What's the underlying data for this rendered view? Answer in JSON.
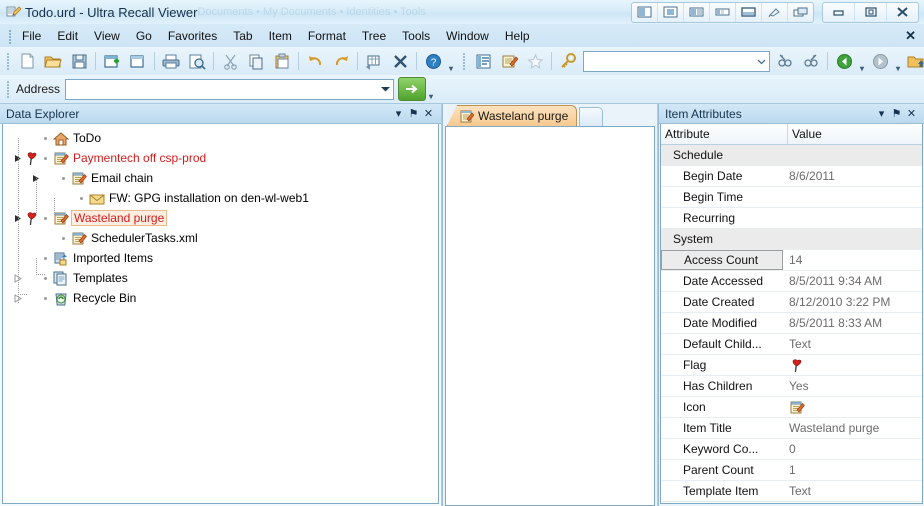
{
  "window": {
    "title": "Todo.urd - Ultra Recall Viewer",
    "app_icon": "notepad-pen-icon",
    "ghost_text": "Documents  •  My Documents  •  Identities  •  Tools",
    "layout_buttons": [
      {
        "name": "layout-split-left-icon"
      },
      {
        "name": "layout-center-icon"
      },
      {
        "name": "layout-list-right-icon"
      },
      {
        "name": "layout-columns-icon"
      },
      {
        "name": "layout-stacked-icon"
      },
      {
        "name": "layout-pin-icon"
      },
      {
        "name": "layout-cascade-icon"
      }
    ],
    "controls": [
      {
        "name": "minimize-button",
        "glyph": "–"
      },
      {
        "name": "maximize-button",
        "glyph": "□"
      },
      {
        "name": "close-button",
        "glyph": "✕"
      }
    ]
  },
  "menubar": {
    "items": [
      "File",
      "Edit",
      "View",
      "Go",
      "Favorites",
      "Tab",
      "Item",
      "Format",
      "Tree",
      "Tools",
      "Window",
      "Help"
    ],
    "close_label": "✕"
  },
  "toolbar": {
    "buttons": [
      {
        "name": "new-document-button"
      },
      {
        "name": "open-folder-button"
      },
      {
        "name": "save-button"
      },
      {
        "name": "new-item-button"
      },
      {
        "name": "new-child-item-button"
      },
      {
        "name": "print-button"
      },
      {
        "name": "print-preview-button"
      },
      {
        "name": "cut-button"
      },
      {
        "name": "copy-button"
      },
      {
        "name": "paste-button"
      },
      {
        "name": "undo-button"
      },
      {
        "name": "redo-button"
      },
      {
        "name": "insert-table-button"
      },
      {
        "name": "delete-button"
      },
      {
        "name": "help-button"
      },
      {
        "name": "outline-view-button"
      },
      {
        "name": "edit-note-button"
      },
      {
        "name": "favorites-star-button"
      },
      {
        "name": "search-key-button"
      },
      {
        "name": "find-previous-button"
      },
      {
        "name": "find-next-button"
      },
      {
        "name": "back-button"
      },
      {
        "name": "forward-button"
      },
      {
        "name": "up-folder-button"
      },
      {
        "name": "stop-button"
      },
      {
        "name": "refresh-button"
      },
      {
        "name": "view-mode-button"
      },
      {
        "name": "properties-button"
      }
    ],
    "search_value": "",
    "search_placeholder": ""
  },
  "address": {
    "label": "Address",
    "value": "",
    "placeholder": "",
    "go_label": "→"
  },
  "explorer": {
    "title": "Data Explorer",
    "buttons": [
      {
        "name": "panel-menu-icon",
        "glyph": "▾"
      },
      {
        "name": "panel-pin-icon",
        "glyph": "⚑"
      },
      {
        "name": "panel-close-icon",
        "glyph": "✕"
      }
    ],
    "tree": [
      {
        "label": "ToDo",
        "icon": "home-icon",
        "indent": 0,
        "expander": "none",
        "flag": false,
        "red": false,
        "selected": false
      },
      {
        "label": "Paymentech off csp-prod",
        "icon": "note-icon",
        "indent": 0,
        "expander": "expanded",
        "flag": true,
        "red": true,
        "selected": false
      },
      {
        "label": "Email chain",
        "icon": "note-icon",
        "indent": 1,
        "expander": "expanded",
        "flag": false,
        "red": false,
        "selected": false
      },
      {
        "label": "FW: GPG installation on den-wl-web1",
        "icon": "envelope-icon",
        "indent": 2,
        "expander": "none",
        "flag": false,
        "red": false,
        "selected": false
      },
      {
        "label": "Wasteland purge",
        "icon": "note-icon",
        "indent": 0,
        "expander": "expanded",
        "flag": true,
        "red": true,
        "selected": true
      },
      {
        "label": "SchedulerTasks.xml",
        "icon": "note-icon",
        "indent": 1,
        "expander": "none",
        "flag": false,
        "red": false,
        "selected": false
      },
      {
        "label": "Imported Items",
        "icon": "imported-items-icon",
        "indent": 0,
        "expander": "none",
        "flag": false,
        "red": false,
        "selected": false
      },
      {
        "label": "Templates",
        "icon": "templates-icon",
        "indent": 0,
        "expander": "collapsed",
        "flag": false,
        "red": false,
        "selected": false
      },
      {
        "label": "Recycle Bin",
        "icon": "recycle-bin-icon",
        "indent": 0,
        "expander": "collapsed",
        "flag": false,
        "red": false,
        "selected": false
      }
    ]
  },
  "document_pane": {
    "active_tab": {
      "label": "Wasteland purge",
      "icon": "note-icon"
    },
    "new_tab_label": ""
  },
  "attributes": {
    "title": "Item Attributes",
    "buttons": [
      {
        "name": "panel-menu-icon",
        "glyph": "▾"
      },
      {
        "name": "panel-pin-icon",
        "glyph": "⚑"
      },
      {
        "name": "panel-close-icon",
        "glyph": "✕"
      }
    ],
    "columns": {
      "attribute": "Attribute",
      "value": "Value"
    },
    "rows": [
      {
        "name": "Schedule",
        "value": "",
        "group": true,
        "selected": false,
        "value_icon": ""
      },
      {
        "name": "Begin Date",
        "value": "8/6/2011",
        "group": false,
        "selected": false,
        "value_icon": ""
      },
      {
        "name": "Begin Time",
        "value": "",
        "group": false,
        "selected": false,
        "value_icon": ""
      },
      {
        "name": "Recurring",
        "value": "",
        "group": false,
        "selected": false,
        "value_icon": ""
      },
      {
        "name": "System",
        "value": "",
        "group": true,
        "selected": false,
        "value_icon": ""
      },
      {
        "name": "Access Count",
        "value": "14",
        "group": false,
        "selected": true,
        "value_icon": ""
      },
      {
        "name": "Date Accessed",
        "value": "8/5/2011 9:34 AM",
        "group": false,
        "selected": false,
        "value_icon": ""
      },
      {
        "name": "Date Created",
        "value": "8/12/2010 3:22 PM",
        "group": false,
        "selected": false,
        "value_icon": ""
      },
      {
        "name": "Date Modified",
        "value": "8/5/2011 8:33 AM",
        "group": false,
        "selected": false,
        "value_icon": ""
      },
      {
        "name": "Default Child...",
        "value": "Text",
        "group": false,
        "selected": false,
        "value_icon": ""
      },
      {
        "name": "Flag",
        "value": "",
        "group": false,
        "selected": false,
        "value_icon": "flag-icon"
      },
      {
        "name": "Has Children",
        "value": "Yes",
        "group": false,
        "selected": false,
        "value_icon": ""
      },
      {
        "name": "Icon",
        "value": "",
        "group": false,
        "selected": false,
        "value_icon": "note-icon"
      },
      {
        "name": "Item Title",
        "value": "Wasteland purge",
        "group": false,
        "selected": false,
        "value_icon": ""
      },
      {
        "name": "Keyword Co...",
        "value": "0",
        "group": false,
        "selected": false,
        "value_icon": ""
      },
      {
        "name": "Parent Count",
        "value": "1",
        "group": false,
        "selected": false,
        "value_icon": ""
      },
      {
        "name": "Template Item",
        "value": "Text",
        "group": false,
        "selected": false,
        "value_icon": ""
      }
    ]
  },
  "colors": {
    "title_bar": "#d6ecf8",
    "accent_blue": "#7fa9c5",
    "tab_orange": "#f6c98e",
    "red_item": "#d01e1e",
    "group_row": "#ebebeb",
    "go_green": "#4fa32d"
  }
}
